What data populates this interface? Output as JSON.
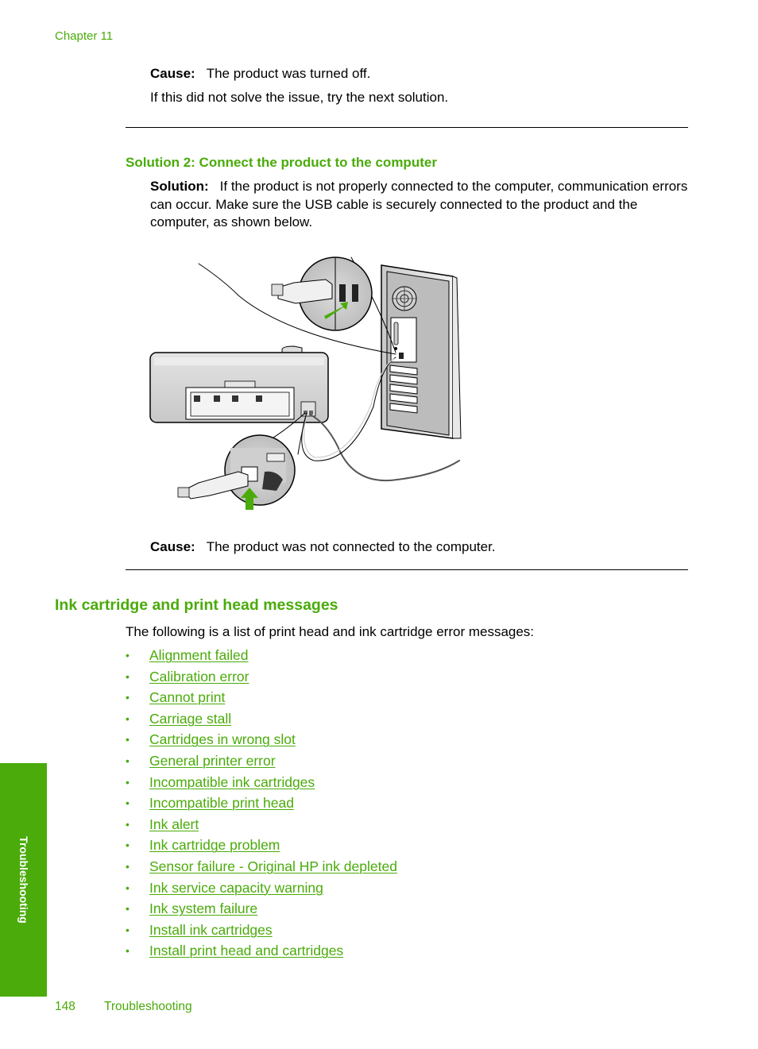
{
  "header": {
    "chapter": "Chapter 11"
  },
  "solution1": {
    "cause_label": "Cause:",
    "cause_text": "The product was turned off.",
    "next_text": "If this did not solve the issue, try the next solution."
  },
  "solution2": {
    "heading": "Solution 2: Connect the product to the computer",
    "solution_label": "Solution:",
    "solution_text": "If the product is not properly connected to the computer, communication errors can occur. Make sure the USB cable is securely connected to the product and the computer, as shown below.",
    "illustration": "usb-cable-connection-diagram",
    "cause_label": "Cause:",
    "cause_text": "The product was not connected to the computer."
  },
  "section": {
    "heading": "Ink cartridge and print head messages",
    "intro": "The following is a list of print head and ink cartridge error messages:",
    "bullet": "•",
    "items": [
      "Alignment failed",
      "Calibration error",
      "Cannot print",
      "Carriage stall",
      "Cartridges in wrong slot",
      "General printer error",
      "Incompatible ink cartridges",
      "Incompatible print head",
      "Ink alert",
      "Ink cartridge problem",
      "Sensor failure - Original HP ink depleted",
      "Ink service capacity warning",
      "Ink system failure",
      "Install ink cartridges",
      "Install print head and cartridges"
    ]
  },
  "side_tab": {
    "label": "Troubleshooting"
  },
  "footer": {
    "page_number": "148",
    "title": "Troubleshooting"
  },
  "colors": {
    "accent": "#4aab0a"
  }
}
